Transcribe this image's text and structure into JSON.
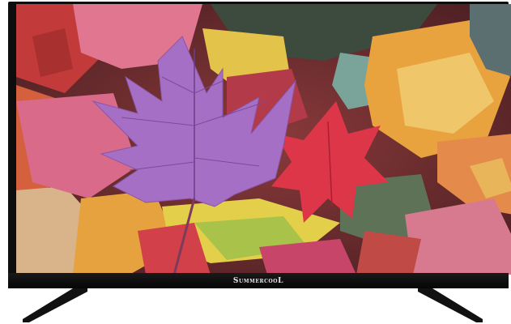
{
  "product": {
    "brand_logo_text": "SummercooL"
  },
  "scene": {
    "subject": "autumn-leaves-wallpaper"
  },
  "colors": {
    "frame": "#0d0d0d",
    "purple_leaf": "#a872c8",
    "red_leaf": "#d9354a",
    "yellow_leaf": "#e8c54a",
    "orange_leaf": "#e69a3a",
    "green_leaf": "#3f5a4a",
    "pink_leaf": "#d96a8a"
  }
}
